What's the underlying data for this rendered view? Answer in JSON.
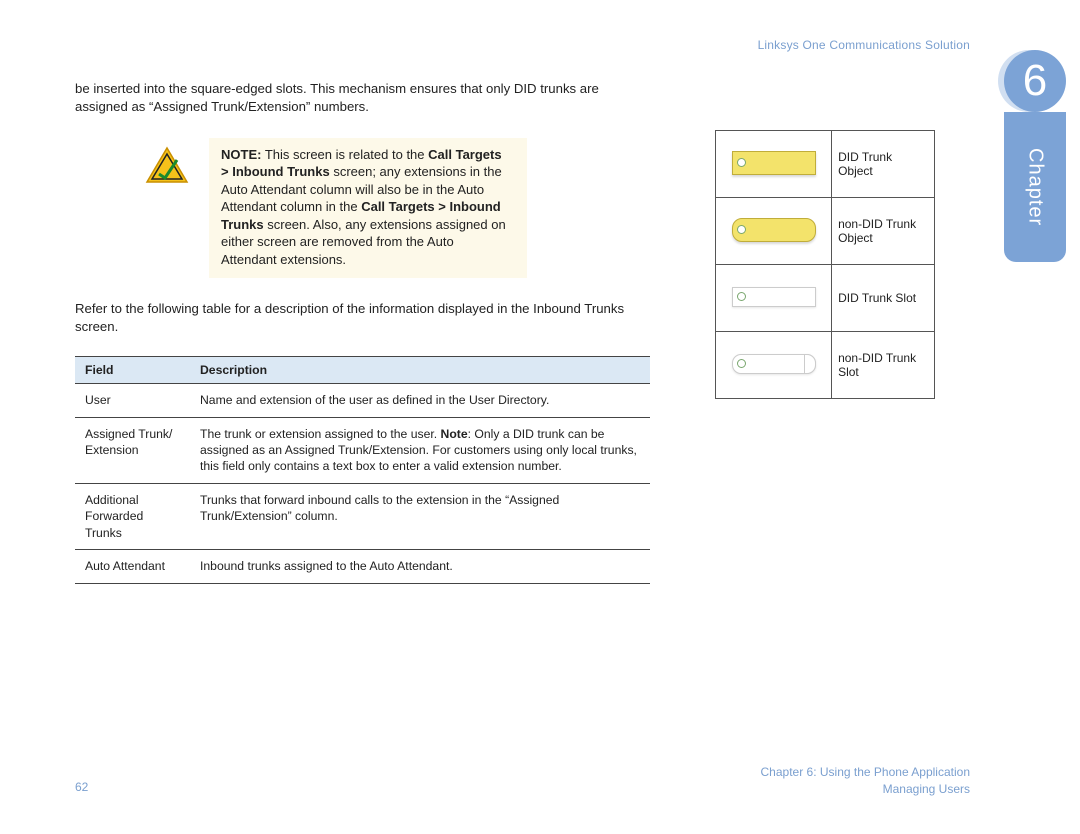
{
  "header": {
    "doc_title": "Linksys One Communications Solution"
  },
  "chapter": {
    "number": "6",
    "label": "Chapter"
  },
  "body": {
    "intro": "be inserted into the square-edged slots. This mechanism ensures that only DID trunks are assigned as “Assigned Trunk/Extension” numbers.",
    "note_prefix": "NOTE:",
    "note_segments": {
      "s1": " This screen is related to the ",
      "b1": "Call Targets > Inbound Trunks",
      "s2": " screen; any extensions in the Auto Attendant column will also be in the Auto Attendant column in the ",
      "b2": "Call Targets > Inbound Trunks",
      "s3": " screen. Also, any extensions assigned on either screen are removed from the Auto Attendant extensions."
    },
    "table_intro": "Refer to the following table for a description of the information displayed in the Inbound Trunks screen."
  },
  "field_table": {
    "headers": {
      "field": "Field",
      "description": "Description"
    },
    "rows": [
      {
        "field": "User",
        "desc_pre": "Name and extension of the user as defined in the User Directory.",
        "desc_bold": "",
        "desc_post": ""
      },
      {
        "field": "Assigned Trunk/ Extension",
        "desc_pre": "The trunk or extension assigned to the user. ",
        "desc_bold": "Note",
        "desc_post": ": Only a DID trunk can be assigned as an Assigned Trunk/Extension. For customers using only local trunks, this field only contains a text box to enter a valid extension number."
      },
      {
        "field": "Additional Forwarded Trunks",
        "desc_pre": "Trunks that forward inbound calls to the extension in the “Assigned Trunk/Extension” column.",
        "desc_bold": "",
        "desc_post": ""
      },
      {
        "field": "Auto Attendant",
        "desc_pre": "Inbound trunks assigned to the Auto Attendant.",
        "desc_bold": "",
        "desc_post": ""
      }
    ]
  },
  "legend": {
    "rows": [
      {
        "label": "DID Trunk Object"
      },
      {
        "label": "non-DID Trunk Object"
      },
      {
        "label": "DID Trunk Slot"
      },
      {
        "label": "non-DID Trunk Slot"
      }
    ]
  },
  "footer": {
    "page_number": "62",
    "chapter_line": "Chapter 6: Using the Phone Application",
    "section_line": "Managing Users"
  }
}
